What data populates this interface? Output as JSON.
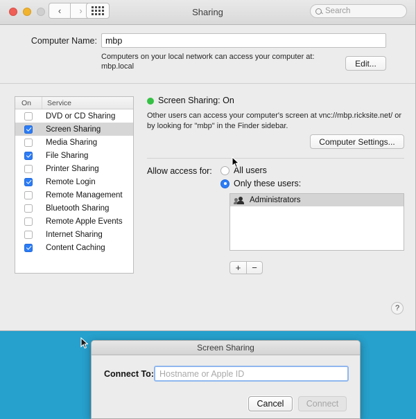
{
  "window": {
    "title": "Sharing",
    "traffic_lights": [
      "close",
      "minimize",
      "zoom"
    ],
    "nav": {
      "back": "‹",
      "forward": "›"
    },
    "showall_icon": "grid-icon"
  },
  "search": {
    "placeholder": "Search",
    "value": "",
    "icon": "search-icon"
  },
  "computer_name": {
    "label": "Computer Name:",
    "value": "mbp",
    "help_line1": "Computers on your local network can access your computer at:",
    "help_line2": "mbp.local",
    "edit_label": "Edit..."
  },
  "services_table": {
    "headers": [
      "On",
      "Service"
    ],
    "selected_index": 1,
    "rows": [
      {
        "name": "DVD or CD Sharing",
        "on": false
      },
      {
        "name": "Screen Sharing",
        "on": true
      },
      {
        "name": "Media Sharing",
        "on": false
      },
      {
        "name": "File Sharing",
        "on": true
      },
      {
        "name": "Printer Sharing",
        "on": false
      },
      {
        "name": "Remote Login",
        "on": true
      },
      {
        "name": "Remote Management",
        "on": false
      },
      {
        "name": "Bluetooth Sharing",
        "on": false
      },
      {
        "name": "Remote Apple Events",
        "on": false
      },
      {
        "name": "Internet Sharing",
        "on": false
      },
      {
        "name": "Content Caching",
        "on": true
      }
    ]
  },
  "detail": {
    "status_text": "Screen Sharing: On",
    "status_color": "#34c144",
    "desc_line1": "Other users can access your computer's screen at vnc://mbp.ricksite.net/ or",
    "desc_line2": "by looking for \"mbp\" in the Finder sidebar.",
    "computer_settings_label": "Computer Settings...",
    "allow_label": "Allow access for:",
    "radio_all_users": "All users",
    "radio_only_these_users": "Only these users:",
    "selected_radio": "only_these_users",
    "users": [
      {
        "name": "Administrators",
        "icon": "group-icon"
      }
    ],
    "add_label": "+",
    "remove_label": "−"
  },
  "help": {
    "label": "?"
  },
  "screen_sharing_dialog": {
    "title": "Screen Sharing",
    "connect_label": "Connect To:",
    "input_value": "",
    "input_placeholder": "Hostname or Apple ID",
    "cancel_label": "Cancel",
    "connect_label_button": "Connect",
    "connect_enabled": false
  },
  "desktop": {
    "background_color": "#26a0cc"
  },
  "accent": {
    "blue": "#2c7cf6",
    "green": "#34c144"
  }
}
